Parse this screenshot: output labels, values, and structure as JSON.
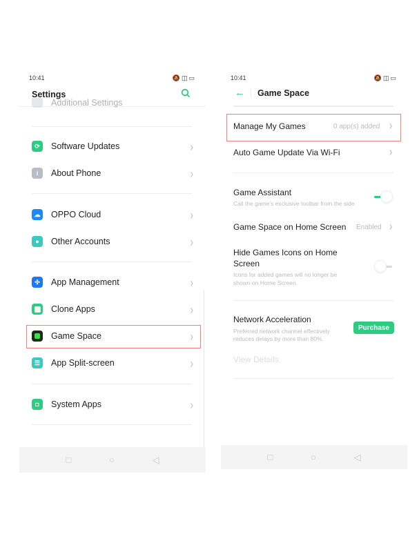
{
  "left": {
    "status": {
      "time": "10:41"
    },
    "header": {
      "title": "Settings",
      "search_icon": "search-icon"
    },
    "partial_item": "Additional Settings",
    "items": [
      {
        "label": "Software Updates",
        "icon": "update-icon",
        "color": "#2ecc82"
      },
      {
        "label": "About Phone",
        "icon": "info-icon",
        "color": "#b8bcc6"
      },
      {
        "label": "OPPO Cloud",
        "icon": "cloud-icon",
        "color": "#1e88f5"
      },
      {
        "label": "Other Accounts",
        "icon": "person-icon",
        "color": "#3cc8c0"
      },
      {
        "label": "App Management",
        "icon": "apps-grid-icon",
        "color": "#1e78f0"
      },
      {
        "label": "Clone Apps",
        "icon": "clone-icon",
        "color": "#2ecc82"
      },
      {
        "label": "Game Space",
        "icon": "game-space-icon",
        "color": "#1c2b1c",
        "highlighted": true
      },
      {
        "label": "App Split-screen",
        "icon": "split-screen-icon",
        "color": "#3cc8c0"
      },
      {
        "label": "System Apps",
        "icon": "android-icon",
        "color": "#2ecc82"
      }
    ]
  },
  "right": {
    "status": {
      "time": "10:41"
    },
    "header": {
      "title": "Game Space",
      "back_icon": "arrow-left-icon"
    },
    "manage_games": {
      "label": "Manage My Games",
      "value": "0 app(s) added",
      "highlighted": true
    },
    "auto_update": {
      "label": "Auto Game Update Via Wi-Fi"
    },
    "game_assistant": {
      "label": "Game Assistant",
      "sub": "Call the game's exclusive toolbar from the side",
      "on": true
    },
    "home_screen": {
      "label": "Game Space on Home Screen",
      "value": "Enabled"
    },
    "hide_icons": {
      "label_1": "Hide Games Icons on Home",
      "label_2": "Screen",
      "sub_1": "Icons for added games will no longer be",
      "sub_2": "shown on Home Screen.",
      "on": false
    },
    "network": {
      "label": "Network Acceleration",
      "sub_1": "Preferred network channel effectively",
      "sub_2": "reduces delays by more than 80%.",
      "button": "Purchase",
      "details": "View Details"
    }
  },
  "colors": {
    "accent": "#2ecc82",
    "highlight": "#f08080"
  }
}
